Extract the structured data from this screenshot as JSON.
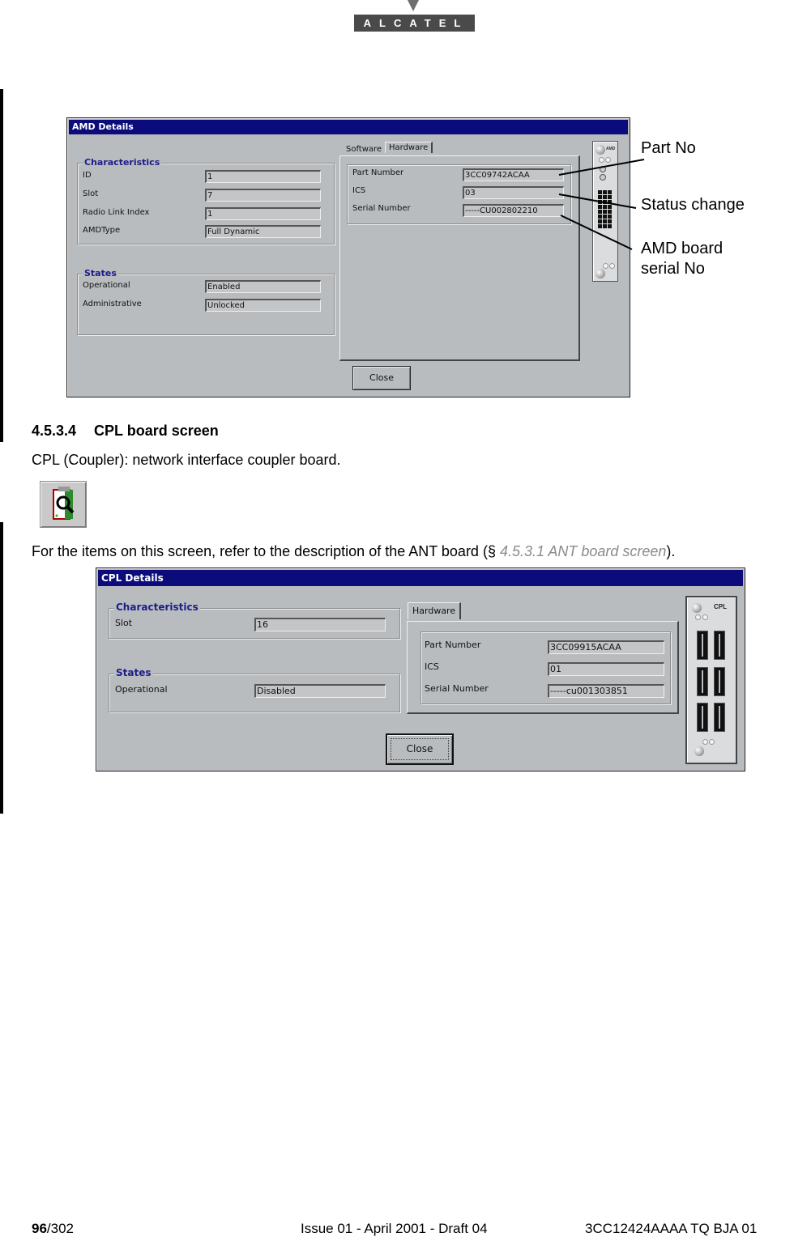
{
  "header": {
    "logo_text": "ALCATEL"
  },
  "amd_dialog": {
    "title": "AMD Details",
    "characteristics": {
      "title": "Characteristics",
      "rows": [
        {
          "label": "ID",
          "value": "1"
        },
        {
          "label": "Slot",
          "value": "7"
        },
        {
          "label": "Radio Link Index",
          "value": "1"
        },
        {
          "label": "AMDType",
          "value": "Full Dynamic"
        }
      ]
    },
    "states": {
      "title": "States",
      "rows": [
        {
          "label": "Operational",
          "value": "Enabled"
        },
        {
          "label": "Administrative",
          "value": "Unlocked"
        }
      ]
    },
    "tabs": [
      {
        "label": "Software",
        "active": false
      },
      {
        "label": "Hardware",
        "active": true
      }
    ],
    "hardware": {
      "rows": [
        {
          "label": "Part Number",
          "value": "3CC09742ACAA"
        },
        {
          "label": "ICS",
          "value": "03"
        },
        {
          "label": "Serial Number",
          "value": "-----CU002802210"
        }
      ]
    },
    "board_label": "AMD",
    "close_label": "Close"
  },
  "callouts": [
    {
      "text": "Part No"
    },
    {
      "text": "Status change"
    },
    {
      "line1": "AMD board",
      "line2": "serial No"
    }
  ],
  "section": {
    "number": "4.5.3.4",
    "title": "CPL board screen",
    "intro": "CPL (Coupler): network interface coupler board.",
    "refer_text_before": "For the items on this screen, refer to the description of the ANT board (§ ",
    "refer_link": "4.5.3.1 ANT board screen",
    "refer_text_after": ")."
  },
  "cpl_dialog": {
    "title": "CPL Details",
    "characteristics": {
      "title": "Characteristics",
      "rows": [
        {
          "label": "Slot",
          "value": "16"
        }
      ]
    },
    "states": {
      "title": "States",
      "rows": [
        {
          "label": "Operational",
          "value": "Disabled"
        }
      ]
    },
    "tabs": [
      {
        "label": "Hardware",
        "active": true
      }
    ],
    "hardware": {
      "rows": [
        {
          "label": "Part Number",
          "value": "3CC09915ACAA"
        },
        {
          "label": "ICS",
          "value": "01"
        },
        {
          "label": "Serial Number",
          "value": "-----cu001303851"
        }
      ]
    },
    "board_label": "CPL",
    "close_label": "Close"
  },
  "footer": {
    "page_current": "96",
    "page_total": "/302",
    "issue": "Issue 01 - April 2001 - Draft 04",
    "doc_ref": "3CC12424AAAA TQ BJA 01"
  }
}
